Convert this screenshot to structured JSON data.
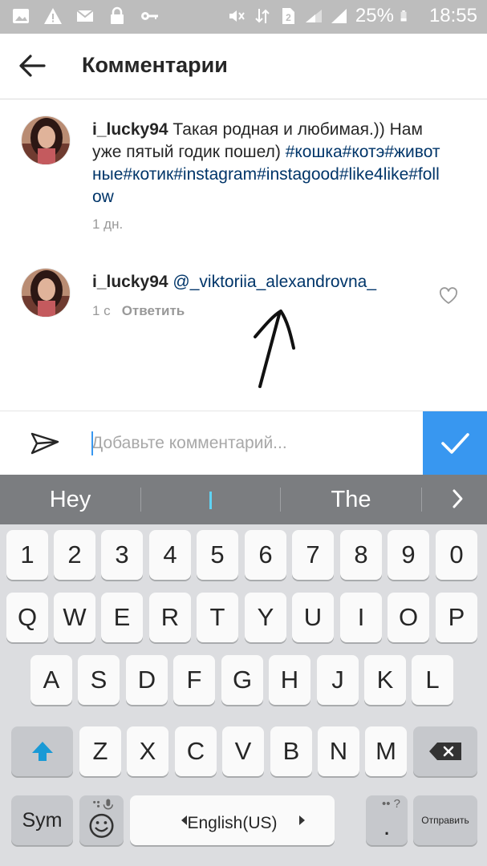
{
  "status_bar": {
    "battery": "25%",
    "time": "18:55",
    "icons": [
      "image-icon",
      "warning-icon",
      "mail-icon",
      "lock-icon",
      "key-icon",
      "mute-icon",
      "data-icon",
      "sim-icon",
      "wifi-icon",
      "signal-icon",
      "battery-icon"
    ]
  },
  "header": {
    "title": "Комментарии"
  },
  "comments": [
    {
      "username": "i_lucky94",
      "text": " Такая родная и любимая.)) Нам уже пятый годик пошел) ",
      "hashtags": "#кошка#котэ#животные#котик#instagram#instagood#like4like#follow",
      "time": "1 дн."
    },
    {
      "username": "i_lucky94",
      "mention": " @_viktoriia_alexandrovna_",
      "time": "1 с",
      "reply_label": "Ответить"
    }
  ],
  "composer": {
    "placeholder": "Добавьте комментарий..."
  },
  "suggestions": [
    "Hey",
    "The"
  ],
  "keyboard": {
    "row_numbers": [
      "1",
      "2",
      "3",
      "4",
      "5",
      "6",
      "7",
      "8",
      "9",
      "0"
    ],
    "row_1": [
      "Q",
      "W",
      "E",
      "R",
      "T",
      "Y",
      "U",
      "I",
      "O",
      "P"
    ],
    "row_2": [
      "A",
      "S",
      "D",
      "F",
      "G",
      "H",
      "J",
      "K",
      "L"
    ],
    "row_3": [
      "Z",
      "X",
      "C",
      "V",
      "B",
      "N",
      "M"
    ],
    "sym_label": "Sym",
    "space_label": "English(US)",
    "period_label": ".",
    "send_label": "Отправить"
  },
  "colors": {
    "accent": "#3897f0",
    "hashtag": "#003569",
    "status_bar": "#bdbdbd",
    "suggest_bar": "#7b7d80",
    "keyboard_bg": "#dcdde0"
  }
}
